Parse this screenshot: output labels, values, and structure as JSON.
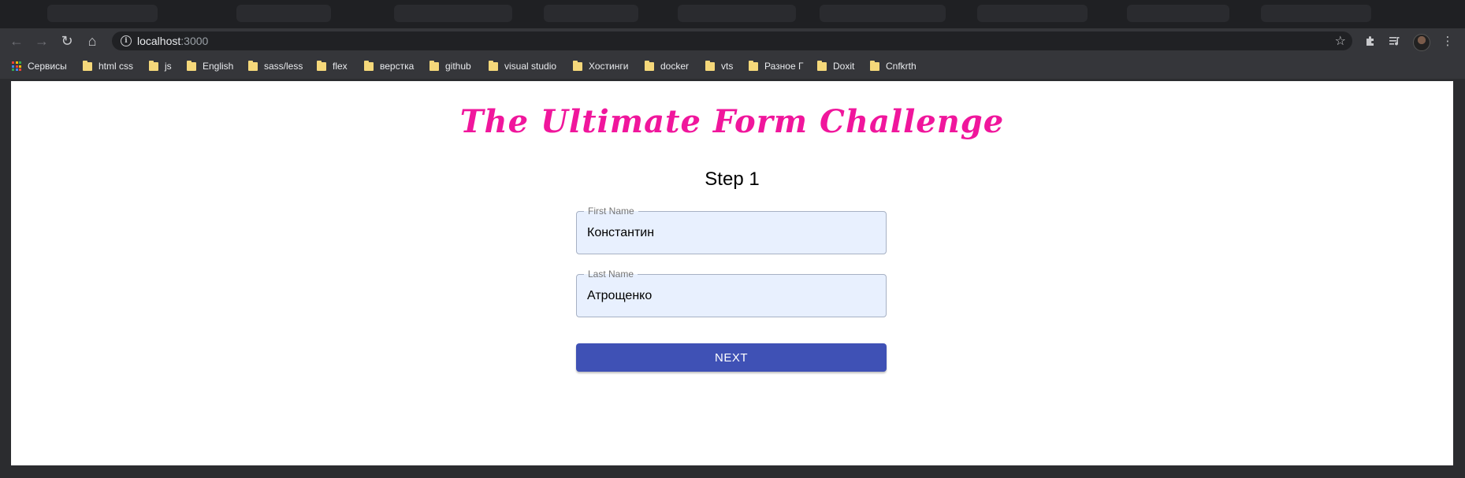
{
  "browser": {
    "url_host": "localhost",
    "url_port": ":3000",
    "bookmarks": [
      {
        "label": "Сервисы",
        "type": "apps"
      },
      {
        "label": "html css",
        "type": "folder"
      },
      {
        "label": "js",
        "type": "folder"
      },
      {
        "label": "English",
        "type": "folder"
      },
      {
        "label": "sass/less",
        "type": "folder"
      },
      {
        "label": "flex",
        "type": "folder"
      },
      {
        "label": "верстка",
        "type": "folder"
      },
      {
        "label": "github",
        "type": "folder"
      },
      {
        "label": "visual studio",
        "type": "folder"
      },
      {
        "label": "Хостинги",
        "type": "folder"
      },
      {
        "label": "docker",
        "type": "folder"
      },
      {
        "label": "vts",
        "type": "folder"
      },
      {
        "label": "Разное Г",
        "type": "folder"
      },
      {
        "label": "Doxit",
        "type": "folder"
      },
      {
        "label": "Cnfkrth",
        "type": "folder"
      }
    ],
    "icons": {
      "back": "arrow-left-icon",
      "forward": "arrow-right-icon",
      "reload": "reload-icon",
      "home": "home-icon",
      "info": "info-icon",
      "bookmark_star": "star-icon",
      "extensions": "puzzle-icon",
      "media": "media-queue-icon",
      "profile": "avatar",
      "menu": "kebab-menu-icon"
    }
  },
  "page": {
    "title": "The Ultimate Form Challenge",
    "step_title": "Step 1",
    "first_name": {
      "label": "First Name",
      "value": "Константин"
    },
    "last_name": {
      "label": "Last Name",
      "value": "Атрощенко"
    },
    "next_label": "NEXT"
  },
  "colors": {
    "title": "#f0169c",
    "button": "#3f51b5",
    "autofill_bg": "#e8f0fe",
    "chrome_dark": "#35363a"
  }
}
